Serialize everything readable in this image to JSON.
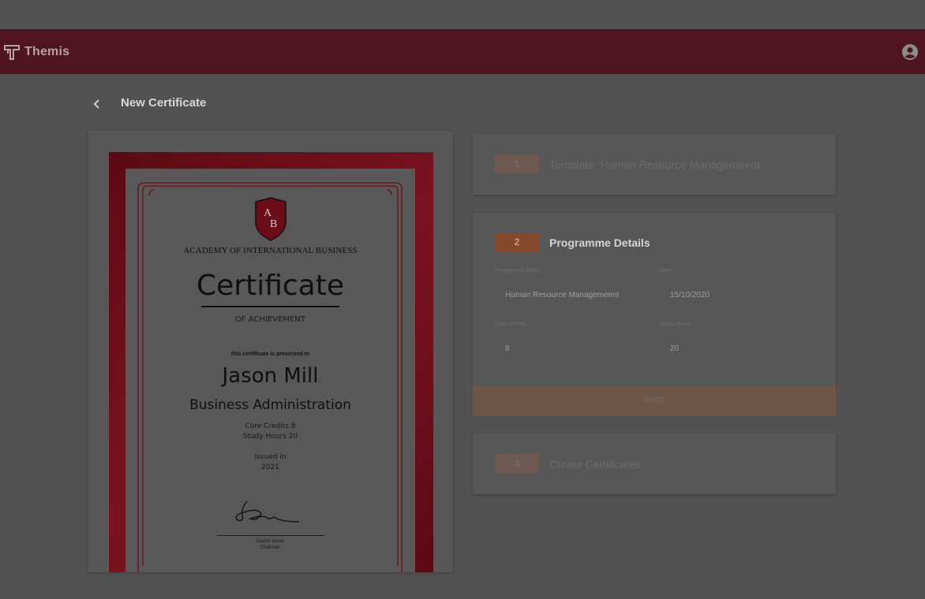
{
  "app": {
    "brand_name": "Themis"
  },
  "header": {
    "account_icon": "account-circle-icon"
  },
  "page": {
    "back_icon": "chevron-left-icon",
    "title": "New Certificate"
  },
  "certificate": {
    "crest_text": "AB",
    "academy": "ACADEMY OF INTERNATIONAL BUSINESS",
    "title": "Certificate",
    "subtitle": "OF ACHIEVEMENT",
    "presented_to": "this certificate is presented to",
    "recipient": "Jason Mill",
    "course": "Business Administration",
    "core_credits": "Core Credits 8",
    "study_hours": "Study Hours 20",
    "issued_in": "Issued in",
    "year": "2021",
    "signer_name": "Daniel Jonas",
    "signer_role": "Chairman"
  },
  "steps": {
    "step1": {
      "number": "1",
      "title": "Template: Human Resource Managemeent"
    },
    "step2": {
      "number": "2",
      "title": "Programme Details",
      "fields": {
        "programme_name": {
          "label": "Programme Name",
          "value": "Human Resource Managemeent"
        },
        "date": {
          "label": "Date",
          "value": "15/10/2020"
        },
        "core_credits": {
          "label": "Core Credits",
          "value": "8"
        },
        "study_hours": {
          "label": "Study Hours",
          "value": "20"
        }
      },
      "next_button": "NEXT"
    },
    "step3": {
      "number": "3",
      "title": "Create Certificates"
    }
  },
  "colors": {
    "header": "#4e1521",
    "background": "#525252",
    "accent": "#86482b",
    "certificate_border": "#7a1222"
  }
}
